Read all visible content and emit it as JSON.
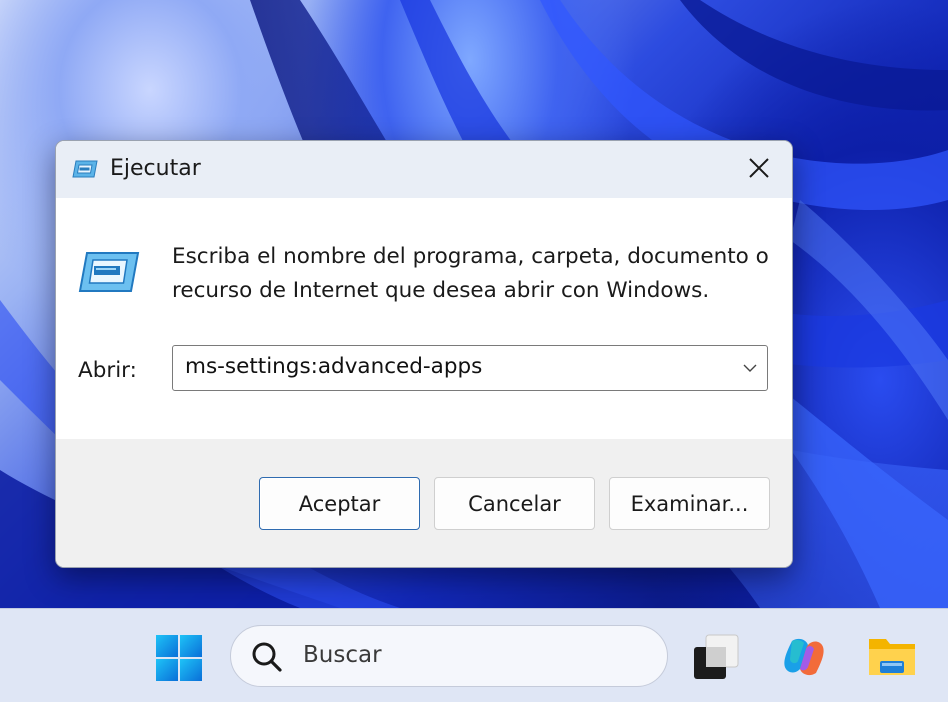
{
  "dialog": {
    "title": "Ejecutar",
    "description": "Escriba el nombre del programa, carpeta, documento o recurso de Internet que desea abrir con Windows.",
    "open_label": "Abrir:",
    "open_value": "ms-settings:advanced-apps",
    "buttons": {
      "ok": "Aceptar",
      "cancel": "Cancelar",
      "browse": "Examinar..."
    },
    "icons": {
      "title": "run-icon",
      "large": "run-icon",
      "close": "close-icon",
      "dropdown": "chevron-down-icon"
    }
  },
  "taskbar": {
    "search_placeholder": "Buscar",
    "icons": [
      "windows-start-icon",
      "search-icon",
      "task-view-icon",
      "copilot-icon",
      "file-explorer-icon"
    ]
  },
  "colors": {
    "accent_border": "#2f6bb0",
    "titlebar_bg": "#e9eef6",
    "footer_bg": "#f0f0f0",
    "taskbar_bg": "#dfe6f5"
  }
}
